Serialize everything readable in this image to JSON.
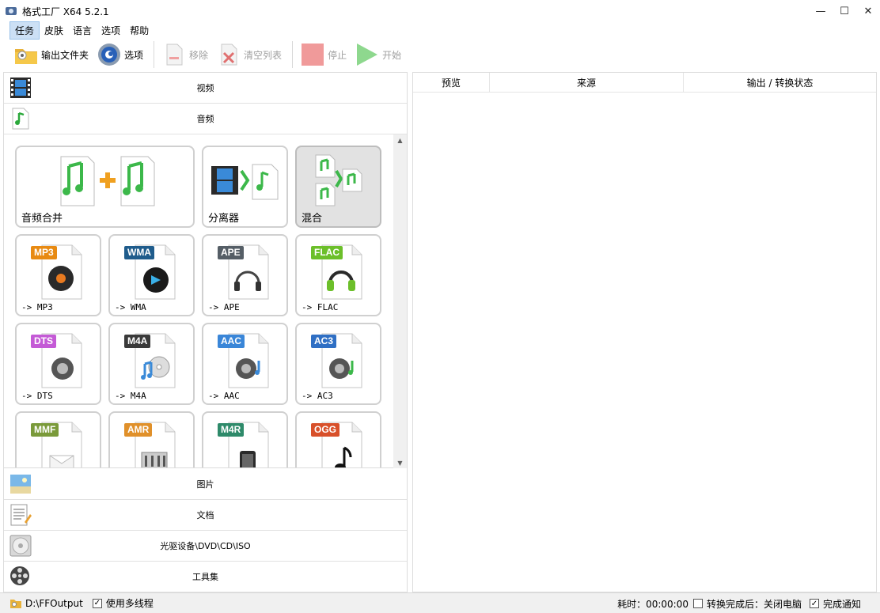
{
  "window": {
    "title": "格式工厂 X64 5.2.1",
    "minimize": "—",
    "maximize": "☐",
    "close": "✕"
  },
  "menu": {
    "items": [
      "任务",
      "皮肤",
      "语言",
      "选项",
      "帮助"
    ],
    "active_index": 0
  },
  "toolbar": {
    "output_folder": "输出文件夹",
    "options": "选项",
    "remove": "移除",
    "clear_list": "清空列表",
    "stop": "停止",
    "start": "开始"
  },
  "categories": {
    "video": "视频",
    "audio": "音频",
    "image": "图片",
    "document": "文档",
    "disc": "光驱设备\\DVD\\CD\\ISO",
    "tools": "工具集"
  },
  "audio_tiles": {
    "merge": "音频合并",
    "splitter": "分离器",
    "mix": "混合",
    "formats": [
      {
        "badge": "MP3",
        "label": "-> MP3",
        "color": "#e88a12"
      },
      {
        "badge": "WMA",
        "label": "-> WMA",
        "color": "#1f5c8c"
      },
      {
        "badge": "APE",
        "label": "-> APE",
        "color": "#555e66"
      },
      {
        "badge": "FLAC",
        "label": "-> FLAC",
        "color": "#6cbf2a"
      },
      {
        "badge": "DTS",
        "label": "-> DTS",
        "color": "#c45ad6"
      },
      {
        "badge": "M4A",
        "label": "-> M4A",
        "color": "#3a3a3a"
      },
      {
        "badge": "AAC",
        "label": "-> AAC",
        "color": "#3a86d8"
      },
      {
        "badge": "AC3",
        "label": "-> AC3",
        "color": "#2f6fc4"
      },
      {
        "badge": "MMF",
        "label": "",
        "color": "#7a9a3a"
      },
      {
        "badge": "AMR",
        "label": "",
        "color": "#e0902a"
      },
      {
        "badge": "M4R",
        "label": "",
        "color": "#2e8a6a"
      },
      {
        "badge": "OGG",
        "label": "",
        "color": "#d8502a"
      }
    ]
  },
  "task_table": {
    "columns": [
      "预览",
      "来源",
      "输出 / 转换状态"
    ]
  },
  "status": {
    "output_path": "D:\\FFOutput",
    "multithread": "使用多线程",
    "elapsed": "耗时：00:00:00",
    "after_convert": "转换完成后：关闭电脑",
    "notify": "完成通知"
  }
}
